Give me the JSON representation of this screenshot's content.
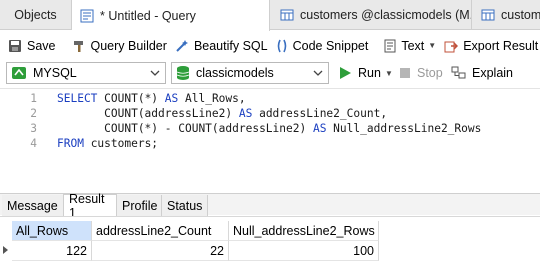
{
  "tabs": [
    {
      "label": "Objects"
    },
    {
      "label": "* Untitled - Query"
    },
    {
      "label": "customers @classicmodels (M..."
    },
    {
      "label": "custome"
    }
  ],
  "toolbar": {
    "save": "Save",
    "query_builder": "Query Builder",
    "beautify": "Beautify SQL",
    "code_snippet": "Code Snippet",
    "text": "Text",
    "export": "Export Result"
  },
  "connection": {
    "value": "MYSQL"
  },
  "database": {
    "value": "classicmodels"
  },
  "run": {
    "run": "Run",
    "stop": "Stop",
    "explain": "Explain"
  },
  "editor": {
    "line_numbers": [
      "1",
      "2",
      "3",
      "4"
    ],
    "lines": [
      {
        "kw1": "SELECT",
        "rest": " COUNT(*) ",
        "kw2": "AS",
        "tail": " All_Rows,"
      },
      {
        "kw1": "",
        "rest": "       COUNT(addressLine2) ",
        "kw2": "AS",
        "tail": " addressLine2_Count,"
      },
      {
        "kw1": "",
        "rest": "       COUNT(*) - COUNT(addressLine2) ",
        "kw2": "AS",
        "tail": " Null_addressLine2_Rows"
      },
      {
        "kw1": "FROM",
        "rest": " customers;",
        "kw2": "",
        "tail": ""
      }
    ]
  },
  "result_tabs": [
    "Message",
    "Result 1",
    "Profile",
    "Status"
  ],
  "result": {
    "columns": [
      "All_Rows",
      "addressLine2_Count",
      "Null_addressLine2_Rows"
    ],
    "rows": [
      [
        "122",
        "22",
        "100"
      ]
    ]
  },
  "colors": {
    "accent_green": "#2e9e3a",
    "keyword_blue": "#1a3ec0",
    "selected_header": "#cfe2fb"
  }
}
